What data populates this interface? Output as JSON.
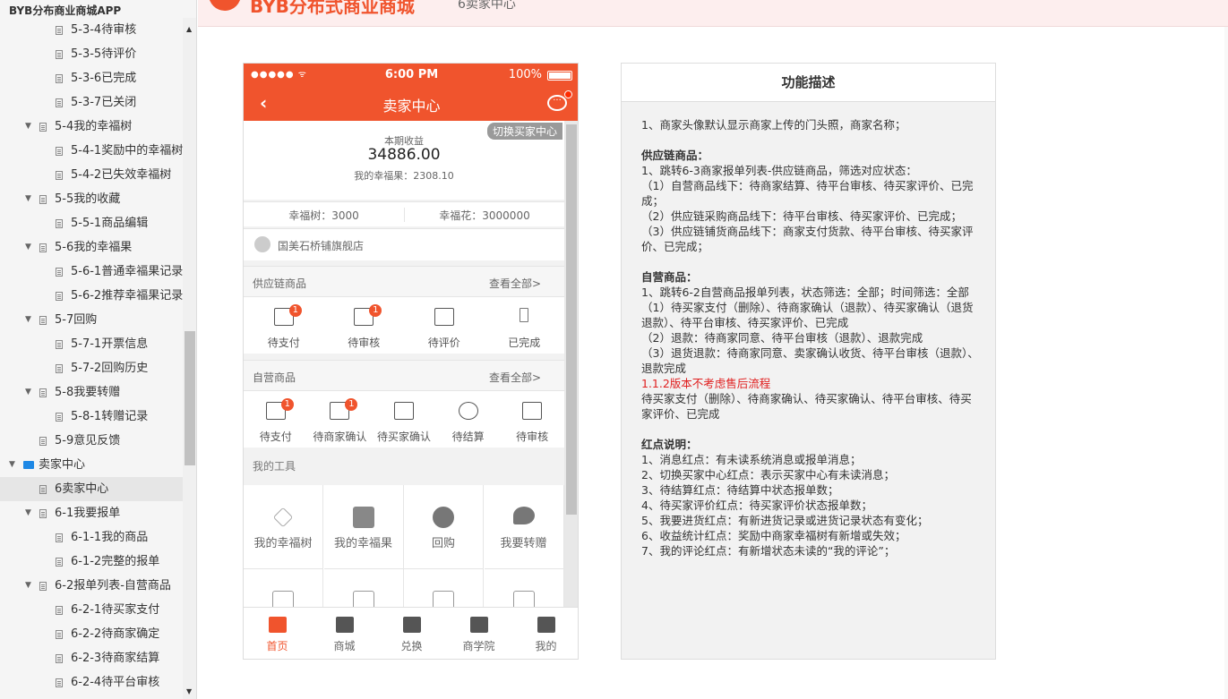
{
  "sidebar": {
    "title": "BYB分布商业商城APP",
    "items": [
      {
        "label": "5-3-4待审核",
        "level": 3,
        "type": "page"
      },
      {
        "label": "5-3-5待评价",
        "level": 3,
        "type": "page"
      },
      {
        "label": "5-3-6已完成",
        "level": 3,
        "type": "page"
      },
      {
        "label": "5-3-7已关闭",
        "level": 3,
        "type": "page"
      },
      {
        "label": "5-4我的幸福树",
        "level": 2,
        "type": "page",
        "expanded": true
      },
      {
        "label": "5-4-1奖励中的幸福树",
        "level": 3,
        "type": "page"
      },
      {
        "label": "5-4-2已失效幸福树",
        "level": 3,
        "type": "page"
      },
      {
        "label": "5-5我的收藏",
        "level": 2,
        "type": "page",
        "expanded": true
      },
      {
        "label": "5-5-1商品编辑",
        "level": 3,
        "type": "page"
      },
      {
        "label": "5-6我的幸福果",
        "level": 2,
        "type": "page",
        "expanded": true
      },
      {
        "label": "5-6-1普通幸福果记录",
        "level": 3,
        "type": "page"
      },
      {
        "label": "5-6-2推荐幸福果记录",
        "level": 3,
        "type": "page"
      },
      {
        "label": "5-7回购",
        "level": 2,
        "type": "page",
        "expanded": true
      },
      {
        "label": "5-7-1开票信息",
        "level": 3,
        "type": "page"
      },
      {
        "label": "5-7-2回购历史",
        "level": 3,
        "type": "page"
      },
      {
        "label": "5-8我要转赠",
        "level": 2,
        "type": "page",
        "expanded": true
      },
      {
        "label": "5-8-1转赠记录",
        "level": 3,
        "type": "page"
      },
      {
        "label": "5-9意见反馈",
        "level": 2,
        "type": "page"
      },
      {
        "label": "卖家中心",
        "level": 1,
        "type": "folder",
        "expanded": true
      },
      {
        "label": "6卖家中心",
        "level": 2,
        "type": "page",
        "selected": true
      },
      {
        "label": "6-1我要报单",
        "level": 2,
        "type": "page",
        "expanded": true
      },
      {
        "label": "6-1-1我的商品",
        "level": 3,
        "type": "page"
      },
      {
        "label": "6-1-2完整的报单",
        "level": 3,
        "type": "page"
      },
      {
        "label": "6-2报单列表-自营商品",
        "level": 2,
        "type": "page",
        "expanded": true
      },
      {
        "label": "6-2-1待买家支付",
        "level": 3,
        "type": "page"
      },
      {
        "label": "6-2-2待商家确定",
        "level": 3,
        "type": "page"
      },
      {
        "label": "6-2-3待商家结算",
        "level": 3,
        "type": "page"
      },
      {
        "label": "6-2-4待平台审核",
        "level": 3,
        "type": "page"
      }
    ]
  },
  "header": {
    "brand": "BYB分布式商业商城",
    "subtitle": "6卖家中心"
  },
  "phone": {
    "status": {
      "signal": "●●●●● ᯤ",
      "time": "6:00 PM",
      "battery": "100%"
    },
    "nav": {
      "back": "‹",
      "title": "卖家中心"
    },
    "switch_label": "切换买家中心",
    "income": {
      "label": "本期收益",
      "value": "34886.00",
      "fruit": "我的幸福果：2308.10"
    },
    "trees": {
      "tree": "幸福树：3000",
      "flower": "幸福花：3000000"
    },
    "shop_name": "国美石桥铺旗舰店",
    "supply": {
      "title": "供应链商品",
      "more": "查看全部>",
      "items": [
        {
          "label": "待支付",
          "badge": "1"
        },
        {
          "label": "待审核",
          "badge": "1"
        },
        {
          "label": "待评价",
          "badge": ""
        },
        {
          "label": "已完成",
          "badge": ""
        }
      ]
    },
    "self": {
      "title": "自营商品",
      "more": "查看全部>",
      "items": [
        {
          "label": "待支付",
          "badge": "1"
        },
        {
          "label": "待商家确认",
          "badge": "1"
        },
        {
          "label": "待买家确认",
          "badge": ""
        },
        {
          "label": "待结算",
          "badge": ""
        },
        {
          "label": "待审核",
          "badge": ""
        }
      ]
    },
    "tools": {
      "title": "我的工具",
      "items": [
        "我的幸福树",
        "我的幸福果",
        "回购",
        "我要转赠"
      ]
    },
    "tabs": [
      {
        "label": "首页",
        "active": true
      },
      {
        "label": "商城"
      },
      {
        "label": "兑换"
      },
      {
        "label": "商学院"
      },
      {
        "label": "我的"
      }
    ]
  },
  "desc": {
    "title": "功能描述",
    "lines": [
      {
        "t": "1、商家头像默认显示商家上传的门头照，商家名称；"
      },
      {
        "t": "",
        "gap": true
      },
      {
        "t": "供应链商品：",
        "bold": true
      },
      {
        "t": "1、跳转6-3商家报单列表-供应链商品，筛选对应状态："
      },
      {
        "t": "（1）自营商品线下：待商家结算、待平台审核、待买家评价、已完成；"
      },
      {
        "t": "（2）供应链采购商品线下：待平台审核、待买家评价、已完成；"
      },
      {
        "t": "（3）供应链铺货商品线下：商家支付货款、待平台审核、待买家评价、已完成；"
      },
      {
        "t": "",
        "gap": true
      },
      {
        "t": "自营商品：",
        "bold": true
      },
      {
        "t": "1、跳转6-2自营商品报单列表，状态筛选：全部；时间筛选：全部"
      },
      {
        "t": "（1）待买家支付（删除）、待商家确认（退款）、待买家确认（退货退款）、待平台审核、待买家评价、已完成"
      },
      {
        "t": "（2）退款：待商家同意、待平台审核（退款）、退款完成"
      },
      {
        "t": "（3）退货退款：待商家同意、卖家确认收货、待平台审核（退款）、退款完成"
      },
      {
        "t": "1.1.2版本不考虑售后流程",
        "red": true
      },
      {
        "t": "待买家支付（删除）、待商家确认、待买家确认、待平台审核、待买家评价、已完成"
      },
      {
        "t": "",
        "gap": true
      },
      {
        "t": "红点说明：",
        "bold": true
      },
      {
        "t": "1、消息红点：有未读系统消息或报单消息；"
      },
      {
        "t": "2、切换买家中心红点：表示买家中心有未读消息；"
      },
      {
        "t": "3、待结算红点：待结算中状态报单数；"
      },
      {
        "t": "4、待买家评价红点：待买家评价状态报单数；"
      },
      {
        "t": "5、我要进货红点：有新进货记录或进货记录状态有变化；"
      },
      {
        "t": "6、收益统计红点：奖励中商家幸福树有新增或失效；"
      },
      {
        "t": "7、我的评论红点：有新增状态未读的“我的评论”；"
      }
    ]
  }
}
